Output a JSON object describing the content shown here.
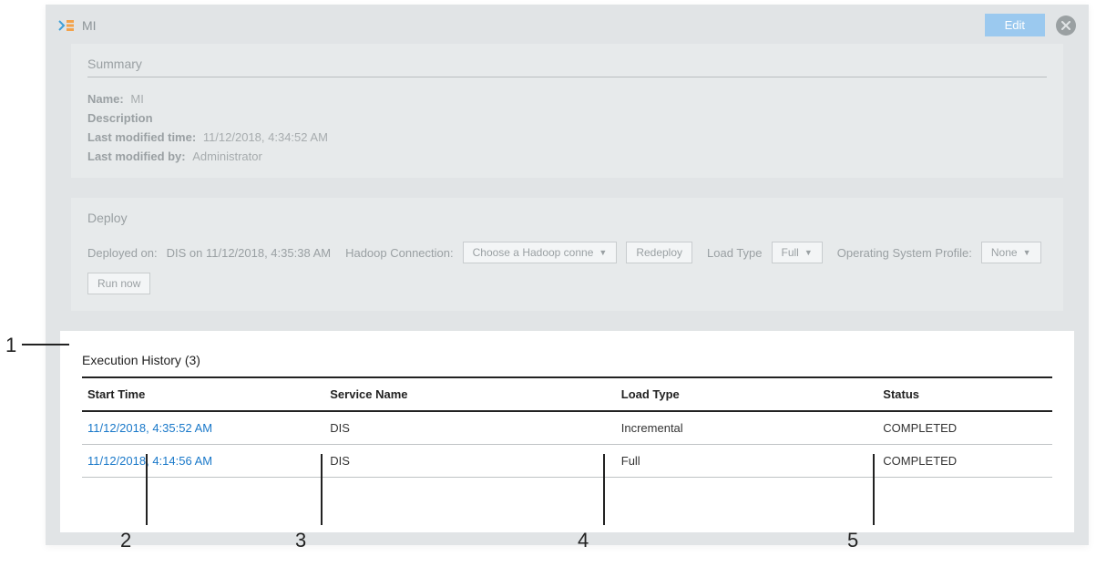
{
  "header": {
    "title": "MI",
    "edit": "Edit"
  },
  "summary": {
    "section_title": "Summary",
    "name_label": "Name:",
    "name_value": "MI",
    "description_label": "Description",
    "last_modified_time_label": "Last modified time:",
    "last_modified_time_value": "11/12/2018, 4:34:52 AM",
    "last_modified_by_label": "Last modified by:",
    "last_modified_by_value": "Administrator"
  },
  "deploy": {
    "section_title": "Deploy",
    "deployed_on_label": "Deployed on:",
    "deployed_on_value": "DIS on 11/12/2018, 4:35:38 AM",
    "hadoop_label": "Hadoop Connection:",
    "hadoop_select": "Choose a Hadoop conne",
    "redeploy": "Redeploy",
    "load_type_label": "Load Type",
    "load_type_value": "Full",
    "os_profile_label": "Operating System Profile:",
    "os_profile_value": "None",
    "run_now": "Run now"
  },
  "execution": {
    "title": "Execution History (3)",
    "headers": {
      "start_time": "Start Time",
      "service_name": "Service Name",
      "load_type": "Load Type",
      "status": "Status"
    },
    "rows": [
      {
        "start_time": "11/12/2018, 4:35:52 AM",
        "service_name": "DIS",
        "load_type": "Incremental",
        "status": "COMPLETED"
      },
      {
        "start_time": "11/12/2018, 4:14:56 AM",
        "service_name": "DIS",
        "load_type": "Full",
        "status": "COMPLETED"
      }
    ]
  },
  "callouts": {
    "n1": "1",
    "n2": "2",
    "n3": "3",
    "n4": "4",
    "n5": "5"
  }
}
